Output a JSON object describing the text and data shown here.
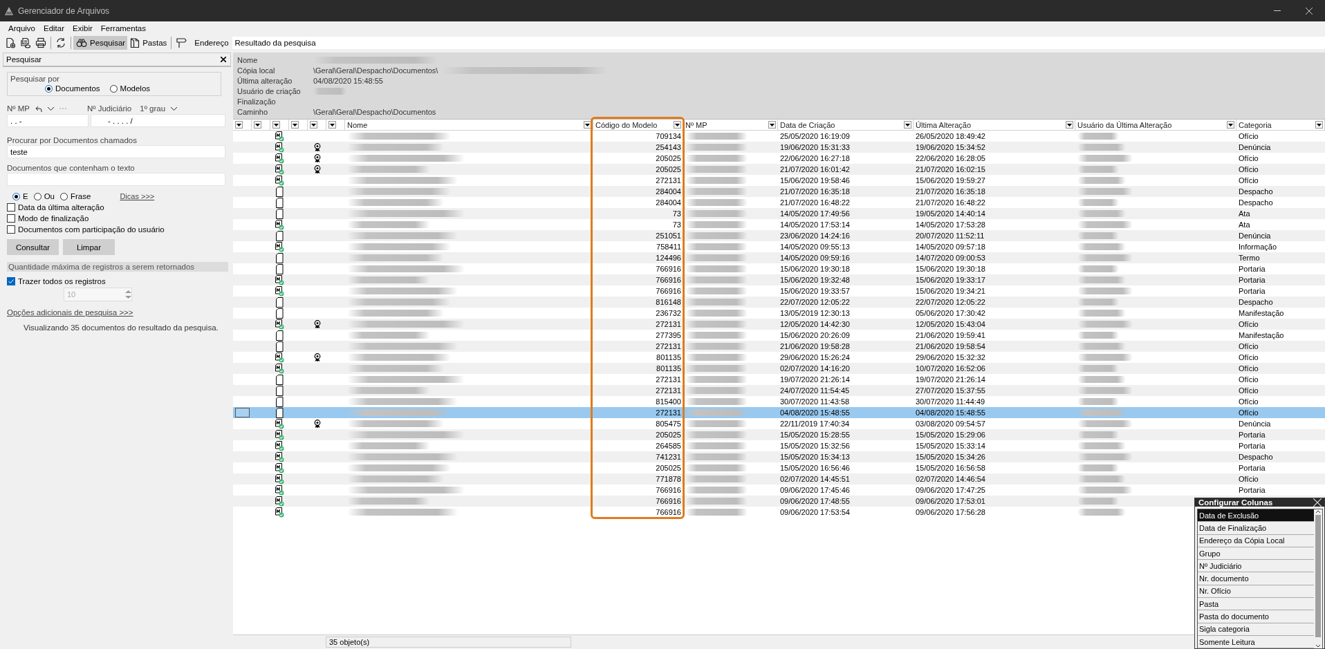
{
  "window": {
    "title": "Gerenciador de Arquivos"
  },
  "menu": [
    {
      "label": "Arquivo"
    },
    {
      "label": "Editar"
    },
    {
      "label": "Exibir"
    },
    {
      "label": "Ferramentas"
    }
  ],
  "toolbar": {
    "tools": [
      {
        "kind": "new",
        "selected": false
      },
      {
        "kind": "scan",
        "selected": false
      },
      {
        "kind": "print",
        "selected": false
      },
      {
        "kind": "refresh",
        "selected": false
      },
      {
        "kind": "search",
        "label": "Pesquisar",
        "selected": true
      },
      {
        "kind": "folders",
        "label": "Pastas",
        "selected": false
      },
      {
        "kind": "address",
        "label": "Endereço",
        "selected": false
      }
    ],
    "address": "Resultado da pesquisa"
  },
  "search_panel": {
    "title": "Pesquisar",
    "search_by": {
      "label": "Pesquisar por",
      "options": [
        {
          "label": "Documentos",
          "selected": true
        },
        {
          "label": "Modelos",
          "selected": false
        }
      ]
    },
    "mp": {
      "label": "Nº MP",
      "value": ".  .     -"
    },
    "judicial": {
      "label": "Nº Judiciário",
      "grade": "1º grau",
      "value": "- .   . . .  /"
    },
    "name_search": {
      "label": "Procurar por Documentos chamados",
      "value": "teste"
    },
    "text_search": {
      "label": "Documentos que contenham o texto"
    },
    "operators": [
      {
        "label": "E",
        "selected": true
      },
      {
        "label": "Ou",
        "selected": false
      },
      {
        "label": "Frase",
        "selected": false
      }
    ],
    "tips_link": "Dicas >>>",
    "filters": [
      {
        "label": "Data da última alteração",
        "checked": false
      },
      {
        "label": "Modo de finalização",
        "checked": false
      },
      {
        "label": "Documentos com participação do usuário",
        "checked": false
      }
    ],
    "buttons": [
      "Consultar",
      "Limpar"
    ],
    "max_section": "Quantidade máxima de registros a serem retornados",
    "all_records": {
      "label": "Trazer todos os registros",
      "checked": true
    },
    "max_count": {
      "value": "10",
      "disabled": true
    },
    "more_link": "Opções adicionais de pesquisa >>>",
    "status": "Visualizando 35 documentos do resultado da pesquisa."
  },
  "details": [
    {
      "label": "Nome",
      "redacted": true
    },
    {
      "label": "Cópia local",
      "value": "\\Geral\\Geral\\Despacho\\Documentos\\",
      "redacted": true
    },
    {
      "label": "Última alteração",
      "value": "04/08/2020 15:48:55",
      "redacted": false
    },
    {
      "label": "Usuário de criação",
      "redacted": true
    },
    {
      "label": "Finalização",
      "redacted": false
    },
    {
      "label": "Caminho",
      "value": "\\Geral\\Geral\\Despacho\\Documentos",
      "redacted": false
    }
  ],
  "table": {
    "columns": [
      {
        "kind": "filter"
      },
      {
        "kind": "filter"
      },
      {
        "kind": "filter"
      },
      {
        "kind": "filter"
      },
      {
        "kind": "filter"
      },
      {
        "kind": "filter"
      },
      {
        "kind": "named",
        "label": "Nome"
      },
      {
        "kind": "named",
        "label": "Código do Modelo"
      },
      {
        "kind": "named",
        "label": "Nº MP"
      },
      {
        "kind": "named",
        "label": "Data de Criação"
      },
      {
        "kind": "named",
        "label": "Última Alteração"
      },
      {
        "kind": "named",
        "label": "Usuário da Última Alteração"
      },
      {
        "kind": "named",
        "label": "Categoria"
      }
    ],
    "rows": [
      {
        "kind": "model",
        "seal": false,
        "code": "709134",
        "created": "25/05/2020 16:19:09",
        "modified": "26/05/2020 18:49:42",
        "category": "Ofício",
        "selected": false
      },
      {
        "kind": "model",
        "seal": true,
        "code": "254143",
        "created": "19/06/2020 15:31:33",
        "modified": "19/06/2020 15:34:52",
        "category": "Denúncia",
        "selected": false
      },
      {
        "kind": "model",
        "seal": true,
        "code": "205025",
        "created": "22/06/2020 16:27:18",
        "modified": "22/06/2020 16:28:05",
        "category": "Ofício",
        "selected": false
      },
      {
        "kind": "model",
        "seal": true,
        "code": "205025",
        "created": "21/07/2020 16:01:42",
        "modified": "21/07/2020 16:02:15",
        "category": "Ofício",
        "selected": false
      },
      {
        "kind": "model",
        "seal": false,
        "code": "272131",
        "created": "15/06/2020 19:58:46",
        "modified": "15/06/2020 19:59:27",
        "category": "Ofício",
        "selected": false
      },
      {
        "kind": "plain",
        "seal": false,
        "code": "284004",
        "created": "21/07/2020 16:35:18",
        "modified": "21/07/2020 16:35:18",
        "category": "Despacho",
        "selected": false
      },
      {
        "kind": "plain",
        "seal": false,
        "code": "284004",
        "created": "21/07/2020 16:48:22",
        "modified": "21/07/2020 16:48:22",
        "category": "Despacho",
        "selected": false
      },
      {
        "kind": "plain",
        "seal": false,
        "code": "73",
        "created": "14/05/2020 17:49:56",
        "modified": "19/05/2020 14:40:14",
        "category": "Ata",
        "selected": false
      },
      {
        "kind": "model",
        "seal": false,
        "code": "73",
        "created": "14/05/2020 17:53:14",
        "modified": "14/05/2020 17:53:28",
        "category": "Ata",
        "selected": false
      },
      {
        "kind": "plain",
        "seal": false,
        "code": "251051",
        "created": "23/06/2020 14:24:16",
        "modified": "20/07/2020 11:52:11",
        "category": "Denúncia",
        "selected": false
      },
      {
        "kind": "model",
        "seal": false,
        "code": "758411",
        "created": "14/05/2020 09:55:13",
        "modified": "14/05/2020 09:57:18",
        "category": "Informação",
        "selected": false
      },
      {
        "kind": "plain",
        "seal": false,
        "code": "124496",
        "created": "14/05/2020 09:59:16",
        "modified": "14/07/2020 09:00:53",
        "category": "Termo",
        "selected": false
      },
      {
        "kind": "plain",
        "seal": false,
        "code": "766916",
        "created": "15/06/2020 19:30:18",
        "modified": "15/06/2020 19:30:18",
        "category": "Portaria",
        "selected": false
      },
      {
        "kind": "model",
        "seal": false,
        "code": "766916",
        "created": "15/06/2020 19:32:48",
        "modified": "15/06/2020 19:33:17",
        "category": "Portaria",
        "selected": false
      },
      {
        "kind": "model",
        "seal": false,
        "code": "766916",
        "created": "15/06/2020 19:33:57",
        "modified": "15/06/2020 19:34:21",
        "category": "Portaria",
        "selected": false
      },
      {
        "kind": "plain",
        "seal": false,
        "code": "816148",
        "created": "22/07/2020 12:05:22",
        "modified": "22/07/2020 12:05:22",
        "category": "Despacho",
        "selected": false
      },
      {
        "kind": "plain",
        "seal": false,
        "code": "236732",
        "created": "13/05/2019 12:30:13",
        "modified": "05/06/2020 17:30:42",
        "category": "Manifestação",
        "selected": false
      },
      {
        "kind": "model",
        "seal": true,
        "code": "272131",
        "created": "12/05/2020 14:42:30",
        "modified": "12/05/2020 15:43:04",
        "category": "Ofício",
        "selected": false
      },
      {
        "kind": "plain",
        "seal": false,
        "code": "277395",
        "created": "15/06/2020 20:26:09",
        "modified": "21/06/2020 19:59:41",
        "category": "Manifestação",
        "selected": false
      },
      {
        "kind": "plain",
        "seal": false,
        "code": "272131",
        "created": "21/06/2020 19:58:28",
        "modified": "21/06/2020 19:58:54",
        "category": "Ofício",
        "selected": false
      },
      {
        "kind": "model",
        "seal": true,
        "code": "801135",
        "created": "29/06/2020 15:26:24",
        "modified": "29/06/2020 15:32:32",
        "category": "Ofício",
        "selected": false
      },
      {
        "kind": "model",
        "seal": false,
        "code": "801135",
        "created": "02/07/2020 14:16:20",
        "modified": "10/07/2020 16:52:06",
        "category": "Ofício",
        "selected": false
      },
      {
        "kind": "plain",
        "seal": false,
        "code": "272131",
        "created": "19/07/2020 21:26:14",
        "modified": "19/07/2020 21:26:14",
        "category": "Ofício",
        "selected": false
      },
      {
        "kind": "plain",
        "seal": false,
        "code": "272131",
        "created": "24/07/2020 11:54:45",
        "modified": "27/07/2020 15:37:55",
        "category": "Ofício",
        "selected": false
      },
      {
        "kind": "plain",
        "seal": false,
        "code": "815400",
        "created": "30/07/2020 11:43:58",
        "modified": "30/07/2020 11:44:49",
        "category": "Ofício",
        "selected": false
      },
      {
        "kind": "plain",
        "seal": false,
        "code": "272131",
        "created": "04/08/2020 15:48:55",
        "modified": "04/08/2020 15:48:55",
        "category": "Ofício",
        "selected": true
      },
      {
        "kind": "model",
        "seal": true,
        "code": "805475",
        "created": "22/11/2019 17:40:34",
        "modified": "03/08/2020 09:54:57",
        "category": "Denúncia",
        "selected": false
      },
      {
        "kind": "model",
        "seal": false,
        "code": "205025",
        "created": "15/05/2020 15:28:55",
        "modified": "15/05/2020 15:29:06",
        "category": "Portaria",
        "selected": false
      },
      {
        "kind": "model",
        "seal": false,
        "code": "264585",
        "created": "15/05/2020 15:32:56",
        "modified": "15/05/2020 15:33:14",
        "category": "Portaria",
        "selected": false
      },
      {
        "kind": "model",
        "seal": false,
        "code": "741231",
        "created": "15/05/2020 15:34:13",
        "modified": "15/05/2020 15:34:26",
        "category": "Despacho",
        "selected": false
      },
      {
        "kind": "model",
        "seal": false,
        "code": "205025",
        "created": "15/05/2020 16:56:46",
        "modified": "15/05/2020 16:56:58",
        "category": "Portaria",
        "selected": false
      },
      {
        "kind": "model",
        "seal": false,
        "code": "771878",
        "created": "02/07/2020 14:45:51",
        "modified": "02/07/2020 14:46:54",
        "category": "Ofício",
        "selected": false
      },
      {
        "kind": "model",
        "seal": false,
        "code": "766916",
        "created": "09/06/2020 17:45:46",
        "modified": "09/06/2020 17:47:25",
        "category": "Portaria",
        "selected": false
      },
      {
        "kind": "model",
        "seal": false,
        "code": "766916",
        "created": "09/06/2020 17:48:55",
        "modified": "09/06/2020 17:53:01",
        "selected": false
      },
      {
        "kind": "model",
        "seal": false,
        "code": "766916",
        "created": "09/06/2020 17:53:54",
        "modified": "09/06/2020 17:56:28",
        "selected": false
      }
    ]
  },
  "status_bar": {
    "count": "35 objeto(s)"
  },
  "column_config": {
    "title": "Configurar Colunas",
    "items": [
      {
        "label": "Data de Exclusão",
        "selected": true
      },
      {
        "label": "Data de Finalização",
        "selected": false
      },
      {
        "label": "Endereço da Cópia Local",
        "selected": false
      },
      {
        "label": "Grupo",
        "selected": false
      },
      {
        "label": "Nº Judiciário",
        "selected": false
      },
      {
        "label": "Nr. documento",
        "selected": false
      },
      {
        "label": "Nr. Ofício",
        "selected": false
      },
      {
        "label": "Pasta",
        "selected": false
      },
      {
        "label": "Pasta do documento",
        "selected": false
      },
      {
        "label": "Sigla categoria",
        "selected": false
      },
      {
        "label": "Somente Leitura",
        "selected": false
      }
    ]
  }
}
